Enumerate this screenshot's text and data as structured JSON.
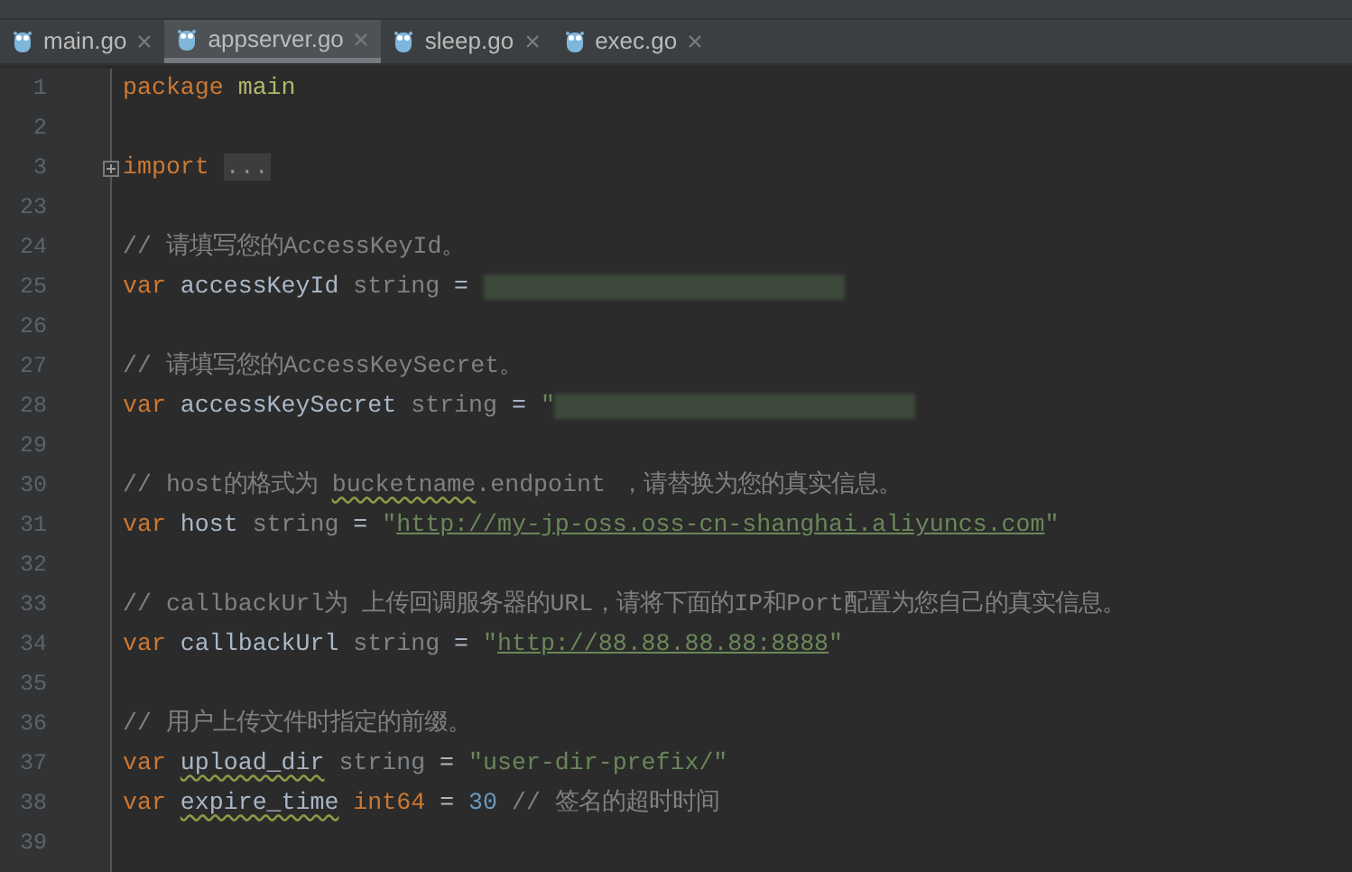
{
  "tabs": [
    {
      "label": "main.go",
      "selected": false
    },
    {
      "label": "appserver.go",
      "selected": true
    },
    {
      "label": "sleep.go",
      "selected": false
    },
    {
      "label": "exec.go",
      "selected": false
    }
  ],
  "lines": [
    {
      "number": "1",
      "tokens": [
        {
          "kind": "keyword",
          "text": "package "
        },
        {
          "kind": "package",
          "text": "main"
        }
      ]
    },
    {
      "number": "2"
    },
    {
      "number": "3",
      "folded": true,
      "tokens": [
        {
          "kind": "keyword",
          "text": "import "
        },
        {
          "kind": "fold",
          "text": "..."
        }
      ]
    },
    {
      "number": "23"
    },
    {
      "number": "24",
      "tokens": [
        {
          "kind": "comment",
          "text": "// 请填写您的AccessKeyId。"
        }
      ]
    },
    {
      "number": "25",
      "tokens": [
        {
          "kind": "keyword",
          "text": "var "
        },
        {
          "kind": "ident",
          "text": "accessKeyId"
        },
        {
          "kind": "type",
          "text": " string"
        },
        {
          "kind": "op",
          "text": " = "
        },
        {
          "kind": "redacted"
        }
      ]
    },
    {
      "number": "26"
    },
    {
      "number": "27",
      "tokens": [
        {
          "kind": "comment",
          "text": "// 请填写您的AccessKeySecret。"
        }
      ]
    },
    {
      "number": "28",
      "tokens": [
        {
          "kind": "keyword",
          "text": "var "
        },
        {
          "kind": "ident",
          "text": "accessKeySecret"
        },
        {
          "kind": "type",
          "text": " string"
        },
        {
          "kind": "op",
          "text": " = "
        },
        {
          "kind": "string",
          "text": "\""
        },
        {
          "kind": "redacted"
        }
      ]
    },
    {
      "number": "29"
    },
    {
      "number": "30",
      "tokens": [
        {
          "kind": "comment",
          "text": "// host的格式为 "
        },
        {
          "kind": "comment",
          "text": "bucketname",
          "squiggle": true
        },
        {
          "kind": "comment",
          "text": ".endpoint ，请替换为您的真实信息。"
        }
      ]
    },
    {
      "number": "31",
      "tokens": [
        {
          "kind": "keyword",
          "text": "var "
        },
        {
          "kind": "ident",
          "text": "host"
        },
        {
          "kind": "type",
          "text": " string"
        },
        {
          "kind": "op",
          "text": " = "
        },
        {
          "kind": "string",
          "text": "\""
        },
        {
          "kind": "url",
          "text": "http://my-jp-oss.oss-cn-shanghai.aliyuncs.com"
        },
        {
          "kind": "string",
          "text": "\""
        }
      ]
    },
    {
      "number": "32"
    },
    {
      "number": "33",
      "tokens": [
        {
          "kind": "comment",
          "text": "// callbackUrl为 上传回调服务器的URL，请将下面的IP和Port配置为您自己的真实信息。"
        }
      ]
    },
    {
      "number": "34",
      "tokens": [
        {
          "kind": "keyword",
          "text": "var "
        },
        {
          "kind": "ident",
          "text": "callbackUrl"
        },
        {
          "kind": "type",
          "text": " string"
        },
        {
          "kind": "op",
          "text": " = "
        },
        {
          "kind": "string",
          "text": "\""
        },
        {
          "kind": "url",
          "text": "http://88.88.88.88:8888"
        },
        {
          "kind": "string",
          "text": "\""
        }
      ]
    },
    {
      "number": "35"
    },
    {
      "number": "36",
      "tokens": [
        {
          "kind": "comment",
          "text": "// 用户上传文件时指定的前缀。"
        }
      ]
    },
    {
      "number": "37",
      "tokens": [
        {
          "kind": "keyword",
          "text": "var "
        },
        {
          "kind": "ident",
          "text": "upload_dir",
          "squiggle": true
        },
        {
          "kind": "type",
          "text": " string"
        },
        {
          "kind": "op",
          "text": " = "
        },
        {
          "kind": "string",
          "text": "\"user-dir-prefix/\""
        }
      ]
    },
    {
      "number": "38",
      "tokens": [
        {
          "kind": "keyword",
          "text": "var "
        },
        {
          "kind": "ident",
          "text": "expire_time",
          "squiggle": true
        },
        {
          "kind": "keyword",
          "text": " int64"
        },
        {
          "kind": "op",
          "text": " = "
        },
        {
          "kind": "number",
          "text": "30"
        },
        {
          "kind": "comment",
          "text": " // 签名的超时时间"
        }
      ]
    },
    {
      "number": "39"
    }
  ]
}
